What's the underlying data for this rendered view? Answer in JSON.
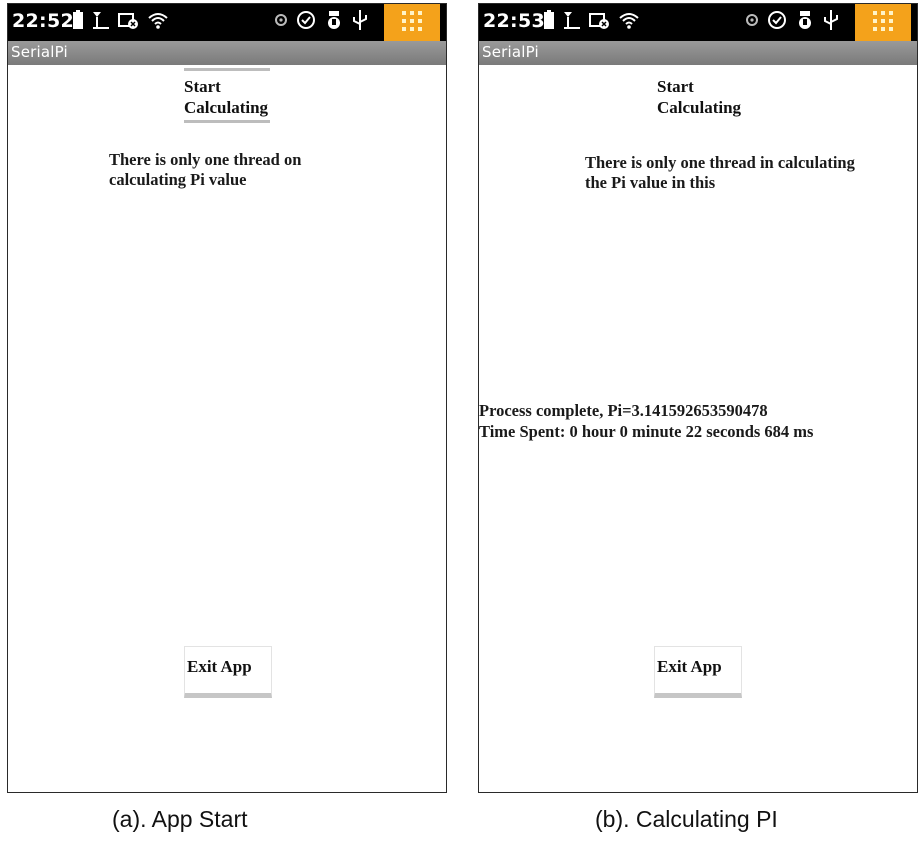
{
  "screens": [
    {
      "status": {
        "time": "22:52"
      },
      "app_title": "SerialPi",
      "start_button": {
        "line1": "Start",
        "line2": "Calculating"
      },
      "description": "There is only one thread on calculating Pi value",
      "result": {
        "line1": "",
        "line2": ""
      },
      "exit_button": "Exit App",
      "caption": "(a). App Start"
    },
    {
      "status": {
        "time": "22:53"
      },
      "app_title": "SerialPi",
      "start_button": {
        "line1": "Start",
        "line2": "Calculating"
      },
      "description": "There is only one thread in calculating the Pi value in this",
      "result": {
        "line1": "Process complete, Pi=3.141592653590478",
        "line2": "Time Spent: 0 hour 0 minute 22 seconds 684 ms"
      },
      "exit_button": "Exit App",
      "caption": "(b). Calculating PI"
    }
  ],
  "colors": {
    "status_bar": "#000000",
    "title_bar": "#8a8a8a",
    "grid_button": "#f4a21b"
  },
  "status_icons_left": [
    "battery-icon",
    "signal-icon",
    "data-icon",
    "wifi-icon"
  ],
  "status_icons_right": [
    "settings-icon",
    "shield-icon",
    "debug-icon",
    "usb-icon"
  ]
}
